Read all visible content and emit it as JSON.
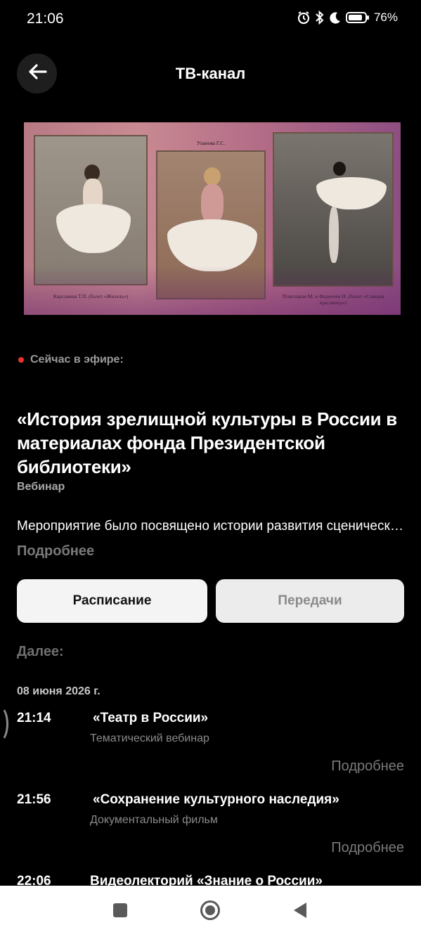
{
  "status_bar": {
    "time": "21:06",
    "battery": "76%",
    "icons": [
      "alarm-icon",
      "bluetooth-icon",
      "moon-icon",
      "battery-icon"
    ]
  },
  "header": {
    "title": "ТВ-канал",
    "back_icon": "arrow-left-icon"
  },
  "banner": {
    "captions": [
      "Карсавина Т.П. (балет «Жизель»)",
      "Уланова Г.С.",
      "Плисецкая М. и Фадеечев Н. (балет «Спящая красавица»)"
    ]
  },
  "now_playing": {
    "live_label": "Сейчас в эфире:",
    "title": "«История зрелищной культуры в России в материалах фонда Президентской библиотеки»",
    "type": "Вебинар",
    "description": "Мероприятие было посвящено истории развития сценического искусства в России",
    "more": "Подробнее"
  },
  "buttons": {
    "schedule": "Расписание",
    "shows": "Передачи"
  },
  "schedule": {
    "next_label": "Далее:",
    "date": "08 июня 2026 г.",
    "items": [
      {
        "time": "21:14",
        "title": "«Театр в России»",
        "type": "Тематический вебинар",
        "more": "Подробнее"
      },
      {
        "time": "21:56",
        "title": "«Сохранение культурного наследия»",
        "type": "Документальный фильм",
        "more": "Подробнее"
      },
      {
        "time": "22:06",
        "title": "Видеолекторий «Знание о России»"
      }
    ]
  },
  "colors": {
    "background": "#000000",
    "live_dot": "#e8332e",
    "primary_button": "#f4f4f4",
    "secondary_button": "#ececec"
  }
}
